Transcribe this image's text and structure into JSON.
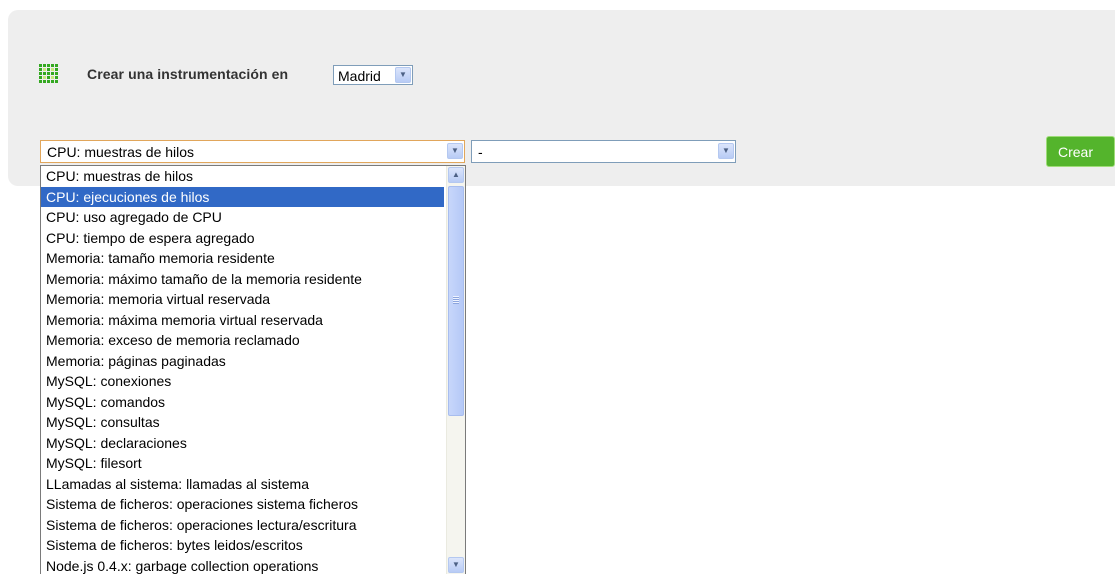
{
  "header": {
    "icon": "grid-icon",
    "create_label": "Crear una instrumentación en",
    "location_value": "Madrid"
  },
  "metric_select": {
    "value": "CPU: muestras de hilos"
  },
  "second_select": {
    "value": "-"
  },
  "create_button": {
    "label": "Crear",
    "color": "#54b42c"
  },
  "dropdown": {
    "selected_index": 1,
    "selection_color": "#3169c6",
    "items": [
      "CPU: muestras de hilos",
      "CPU: ejecuciones de hilos",
      "CPU: uso agregado de CPU",
      "CPU: tiempo de espera agregado",
      "Memoria: tamaño memoria residente",
      "Memoria: máximo tamaño de la memoria residente",
      "Memoria: memoria virtual reservada",
      "Memoria: máxima memoria virtual reservada",
      "Memoria: exceso de memoria reclamado",
      "Memoria: páginas paginadas",
      "MySQL: conexiones",
      "MySQL: comandos",
      "MySQL: consultas",
      "MySQL: declaraciones",
      "MySQL: filesort",
      "LLamadas al sistema: llamadas al sistema",
      "Sistema de ficheros: operaciones sistema ficheros",
      "Sistema de ficheros: operaciones lectura/escritura",
      "Sistema de ficheros: bytes leidos/escritos",
      "Node.js 0.4.x: garbage collection operations"
    ]
  }
}
